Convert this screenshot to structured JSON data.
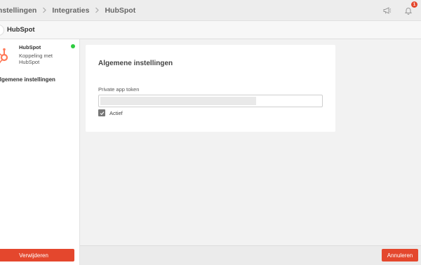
{
  "breadcrumb": [
    "Instellingen",
    "Integraties",
    "HubSpot"
  ],
  "topbar": {
    "notification_count": "1"
  },
  "header": {
    "title": "HubSpot"
  },
  "sidebar": {
    "app": {
      "name": "HubSpot",
      "description": "Koppeling met HubSpot",
      "status": "connected"
    },
    "items": [
      {
        "label": "Algemene instellingen"
      }
    ],
    "delete_label": "Verwijderen"
  },
  "card": {
    "title": "Algemene instellingen",
    "token_label": "Private app token",
    "token_value": "",
    "active_label": "Actief",
    "active_checked": true
  },
  "footer": {
    "cancel_label": "Annuleren"
  },
  "colors": {
    "accent": "#e4472d",
    "status": "#2ecc40",
    "hubspot": "#ff7a59"
  }
}
